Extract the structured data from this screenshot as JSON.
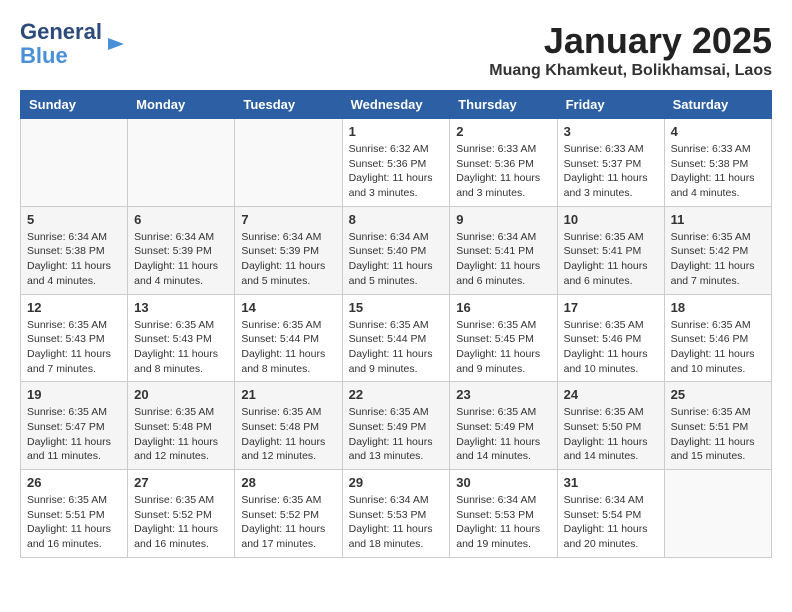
{
  "logo": {
    "line1": "General",
    "line2": "Blue"
  },
  "title": "January 2025",
  "subtitle": "Muang Khamkeut, Bolikhamsai, Laos",
  "days_header": [
    "Sunday",
    "Monday",
    "Tuesday",
    "Wednesday",
    "Thursday",
    "Friday",
    "Saturday"
  ],
  "weeks": [
    [
      {
        "day": "",
        "info": ""
      },
      {
        "day": "",
        "info": ""
      },
      {
        "day": "",
        "info": ""
      },
      {
        "day": "1",
        "info": "Sunrise: 6:32 AM\nSunset: 5:36 PM\nDaylight: 11 hours\nand 3 minutes."
      },
      {
        "day": "2",
        "info": "Sunrise: 6:33 AM\nSunset: 5:36 PM\nDaylight: 11 hours\nand 3 minutes."
      },
      {
        "day": "3",
        "info": "Sunrise: 6:33 AM\nSunset: 5:37 PM\nDaylight: 11 hours\nand 3 minutes."
      },
      {
        "day": "4",
        "info": "Sunrise: 6:33 AM\nSunset: 5:38 PM\nDaylight: 11 hours\nand 4 minutes."
      }
    ],
    [
      {
        "day": "5",
        "info": "Sunrise: 6:34 AM\nSunset: 5:38 PM\nDaylight: 11 hours\nand 4 minutes."
      },
      {
        "day": "6",
        "info": "Sunrise: 6:34 AM\nSunset: 5:39 PM\nDaylight: 11 hours\nand 4 minutes."
      },
      {
        "day": "7",
        "info": "Sunrise: 6:34 AM\nSunset: 5:39 PM\nDaylight: 11 hours\nand 5 minutes."
      },
      {
        "day": "8",
        "info": "Sunrise: 6:34 AM\nSunset: 5:40 PM\nDaylight: 11 hours\nand 5 minutes."
      },
      {
        "day": "9",
        "info": "Sunrise: 6:34 AM\nSunset: 5:41 PM\nDaylight: 11 hours\nand 6 minutes."
      },
      {
        "day": "10",
        "info": "Sunrise: 6:35 AM\nSunset: 5:41 PM\nDaylight: 11 hours\nand 6 minutes."
      },
      {
        "day": "11",
        "info": "Sunrise: 6:35 AM\nSunset: 5:42 PM\nDaylight: 11 hours\nand 7 minutes."
      }
    ],
    [
      {
        "day": "12",
        "info": "Sunrise: 6:35 AM\nSunset: 5:43 PM\nDaylight: 11 hours\nand 7 minutes."
      },
      {
        "day": "13",
        "info": "Sunrise: 6:35 AM\nSunset: 5:43 PM\nDaylight: 11 hours\nand 8 minutes."
      },
      {
        "day": "14",
        "info": "Sunrise: 6:35 AM\nSunset: 5:44 PM\nDaylight: 11 hours\nand 8 minutes."
      },
      {
        "day": "15",
        "info": "Sunrise: 6:35 AM\nSunset: 5:44 PM\nDaylight: 11 hours\nand 9 minutes."
      },
      {
        "day": "16",
        "info": "Sunrise: 6:35 AM\nSunset: 5:45 PM\nDaylight: 11 hours\nand 9 minutes."
      },
      {
        "day": "17",
        "info": "Sunrise: 6:35 AM\nSunset: 5:46 PM\nDaylight: 11 hours\nand 10 minutes."
      },
      {
        "day": "18",
        "info": "Sunrise: 6:35 AM\nSunset: 5:46 PM\nDaylight: 11 hours\nand 10 minutes."
      }
    ],
    [
      {
        "day": "19",
        "info": "Sunrise: 6:35 AM\nSunset: 5:47 PM\nDaylight: 11 hours\nand 11 minutes."
      },
      {
        "day": "20",
        "info": "Sunrise: 6:35 AM\nSunset: 5:48 PM\nDaylight: 11 hours\nand 12 minutes."
      },
      {
        "day": "21",
        "info": "Sunrise: 6:35 AM\nSunset: 5:48 PM\nDaylight: 11 hours\nand 12 minutes."
      },
      {
        "day": "22",
        "info": "Sunrise: 6:35 AM\nSunset: 5:49 PM\nDaylight: 11 hours\nand 13 minutes."
      },
      {
        "day": "23",
        "info": "Sunrise: 6:35 AM\nSunset: 5:49 PM\nDaylight: 11 hours\nand 14 minutes."
      },
      {
        "day": "24",
        "info": "Sunrise: 6:35 AM\nSunset: 5:50 PM\nDaylight: 11 hours\nand 14 minutes."
      },
      {
        "day": "25",
        "info": "Sunrise: 6:35 AM\nSunset: 5:51 PM\nDaylight: 11 hours\nand 15 minutes."
      }
    ],
    [
      {
        "day": "26",
        "info": "Sunrise: 6:35 AM\nSunset: 5:51 PM\nDaylight: 11 hours\nand 16 minutes."
      },
      {
        "day": "27",
        "info": "Sunrise: 6:35 AM\nSunset: 5:52 PM\nDaylight: 11 hours\nand 16 minutes."
      },
      {
        "day": "28",
        "info": "Sunrise: 6:35 AM\nSunset: 5:52 PM\nDaylight: 11 hours\nand 17 minutes."
      },
      {
        "day": "29",
        "info": "Sunrise: 6:34 AM\nSunset: 5:53 PM\nDaylight: 11 hours\nand 18 minutes."
      },
      {
        "day": "30",
        "info": "Sunrise: 6:34 AM\nSunset: 5:53 PM\nDaylight: 11 hours\nand 19 minutes."
      },
      {
        "day": "31",
        "info": "Sunrise: 6:34 AM\nSunset: 5:54 PM\nDaylight: 11 hours\nand 20 minutes."
      },
      {
        "day": "",
        "info": ""
      }
    ]
  ]
}
